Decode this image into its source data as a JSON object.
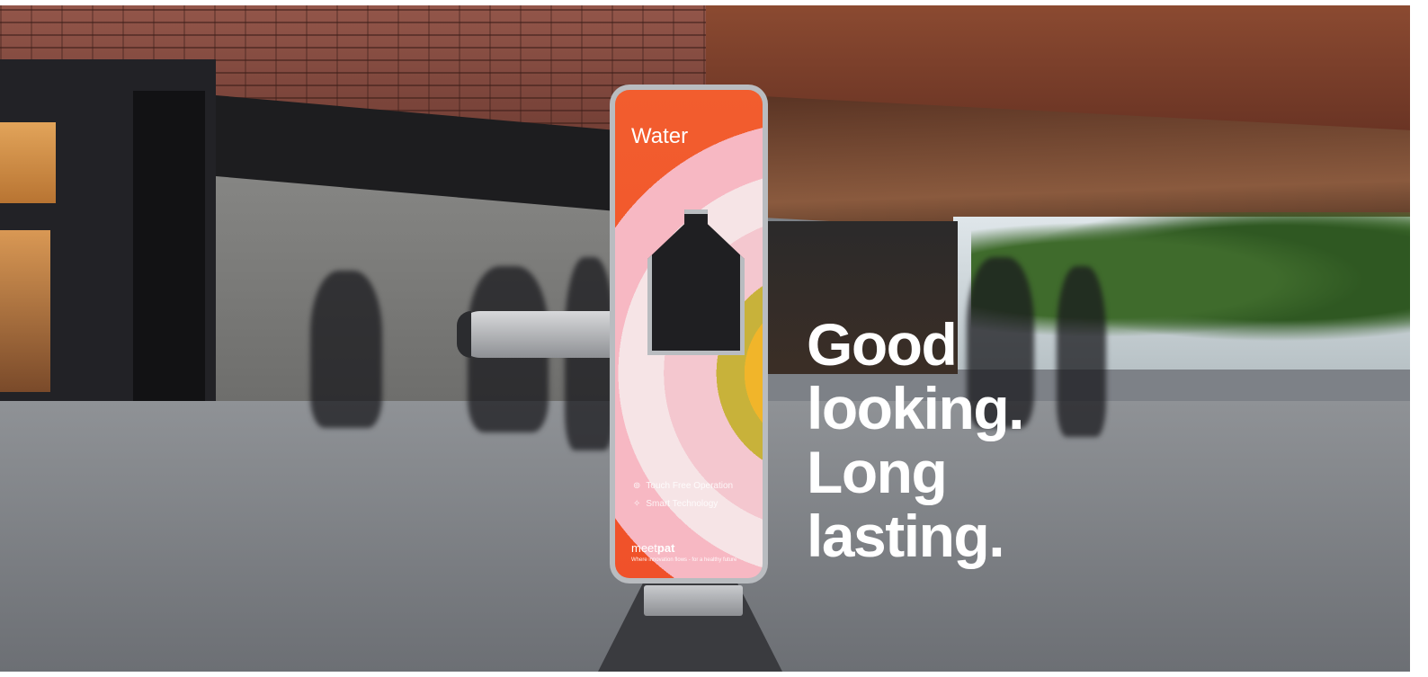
{
  "image": {
    "description_icons": [
      "touch-free-icon",
      "smart-technology-icon"
    ]
  },
  "kiosk": {
    "label": "Water",
    "features": [
      {
        "icon": "touch-free-icon",
        "text": "Touch Free Operation"
      },
      {
        "icon": "smart-technology-icon",
        "text": "Smart Technology"
      }
    ],
    "brand_light": "meet",
    "brand_bold": "pat",
    "tagline": "Where innovation flows - for a healthy future",
    "accent_color": "#f25d2e"
  },
  "headline": {
    "lines": [
      "Good",
      "looking.",
      "Long",
      "lasting."
    ]
  }
}
